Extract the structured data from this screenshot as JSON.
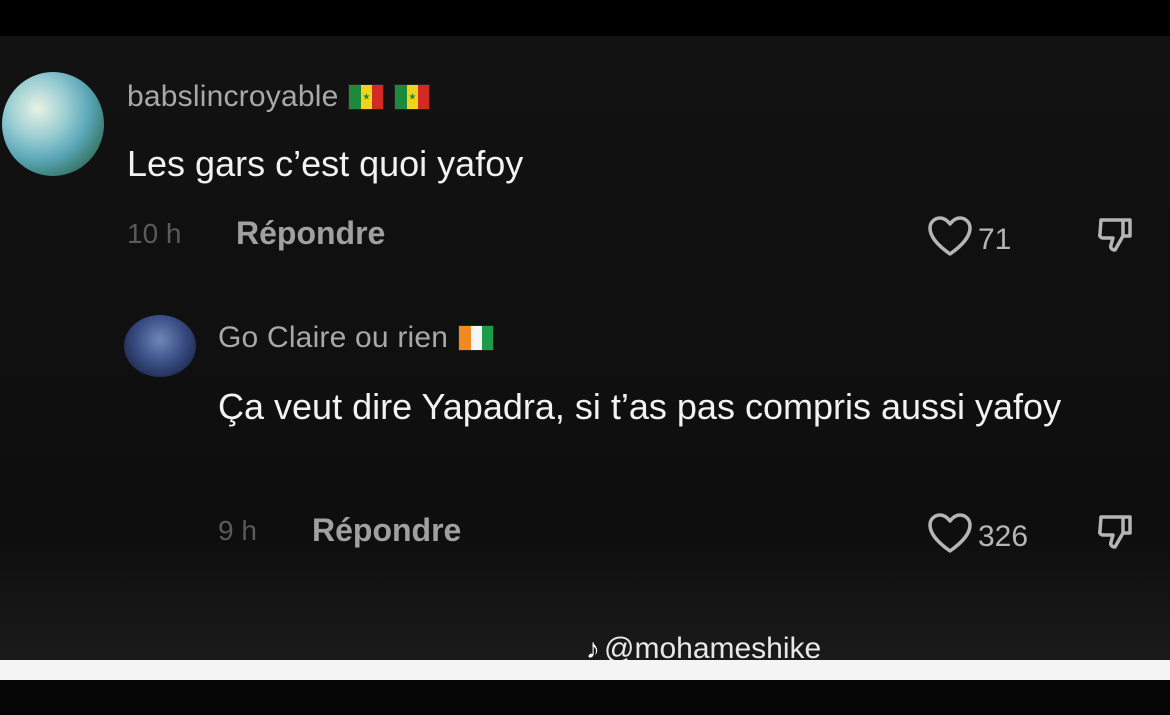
{
  "comments": [
    {
      "username": "babslincroyable",
      "flags": [
        "senegal-flag",
        "senegal-flag"
      ],
      "text": "Les gars c’est quoi yafoy",
      "time": "10 h",
      "reply_label": "Répondre",
      "likes": "71"
    },
    {
      "username": "Go Claire ou rien",
      "flags": [
        "ivory-coast-flag"
      ],
      "text": "Ça veut dire Yapadra, si t’as pas compris aussi yafoy",
      "time": "9 h",
      "reply_label": "Répondre",
      "likes": "326"
    }
  ],
  "watermark": {
    "icon": "tiktok-icon",
    "handle": "@mohameshike"
  },
  "colors": {
    "background": "#121212",
    "username": "#a8a8a8",
    "comment_text": "#f2f2f2",
    "meta": "#5a5a5a"
  }
}
